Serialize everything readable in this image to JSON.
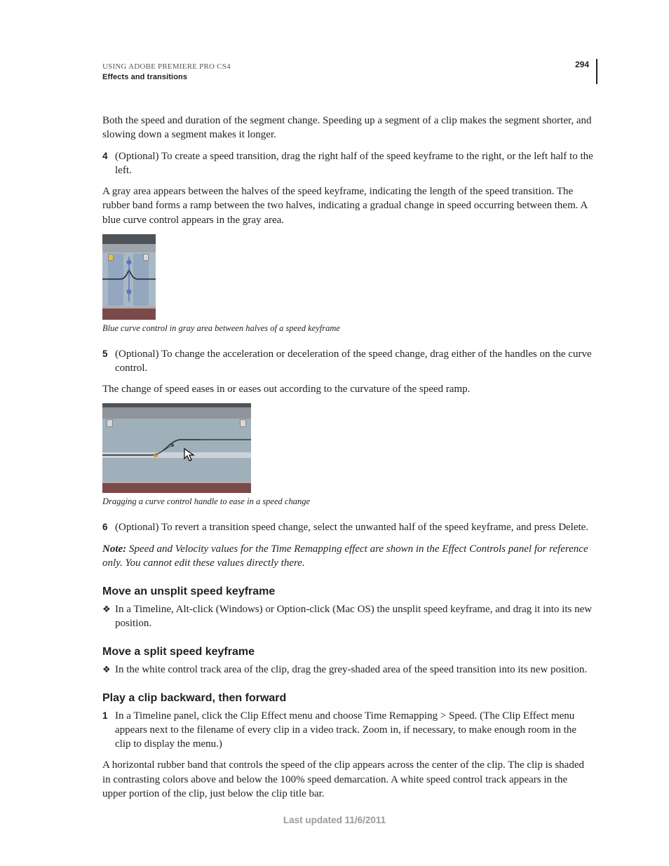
{
  "header": {
    "title": "USING ADOBE PREMIERE PRO CS4",
    "section": "Effects and transitions",
    "page_number": "294"
  },
  "body": {
    "p_intro": "Both the speed and duration of the segment change. Speeding up a segment of a clip makes the segment shorter, and slowing down a segment makes it longer.",
    "step4_num": "4",
    "step4_text": "(Optional) To create a speed transition, drag the right half of the speed keyframe to the right, or the left half to the left.",
    "p_gray": "A gray area appears between the halves of the speed keyframe, indicating the length of the speed transition. The rubber band forms a ramp between the two halves, indicating a gradual change in speed occurring between them. A blue curve control appears in the gray area.",
    "fig1_caption": "Blue curve control in gray area between halves of a speed keyframe",
    "step5_num": "5",
    "step5_text": "(Optional) To change the acceleration or deceleration of the speed change, drag either of the handles on the curve control.",
    "p_ease": "The change of speed eases in or eases out according to the curvature of the speed ramp.",
    "fig2_caption": "Dragging a curve control handle to ease in a speed change",
    "step6_num": "6",
    "step6_text": "(Optional) To revert a transition speed change, select the unwanted half of the speed keyframe, and press Delete.",
    "note_label": "Note:",
    "note_text": " Speed and Velocity values for the Time Remapping effect are shown in the Effect Controls panel for reference only. You cannot edit these values directly there.",
    "h_move_unsplit": "Move an unsplit speed keyframe",
    "bullet_unsplit": "In a Timeline, Alt-click (Windows) or Option-click (Mac OS) the unsplit speed keyframe, and drag it into its new position.",
    "h_move_split": "Move a split speed keyframe",
    "bullet_split": "In the white control track area of the clip, drag the grey-shaded area of the speed transition into its new position.",
    "h_play_back": "Play a clip backward, then forward",
    "step1b_num": "1",
    "step1b_text": "In a Timeline panel, click the Clip Effect menu and choose Time Remapping > Speed. (The Clip Effect menu appears next to the filename of every clip in a video track. Zoom in, if necessary, to make enough room in the clip to display the menu.)",
    "p_horizontal": "A horizontal rubber band that controls the speed of the clip appears across the center of the clip. The clip is shaded in contrasting colors above and below the 100% speed demarcation. A white speed control track appears in the upper portion of the clip, just below the clip title bar."
  },
  "footer": {
    "updated": "Last updated 11/6/2011"
  }
}
